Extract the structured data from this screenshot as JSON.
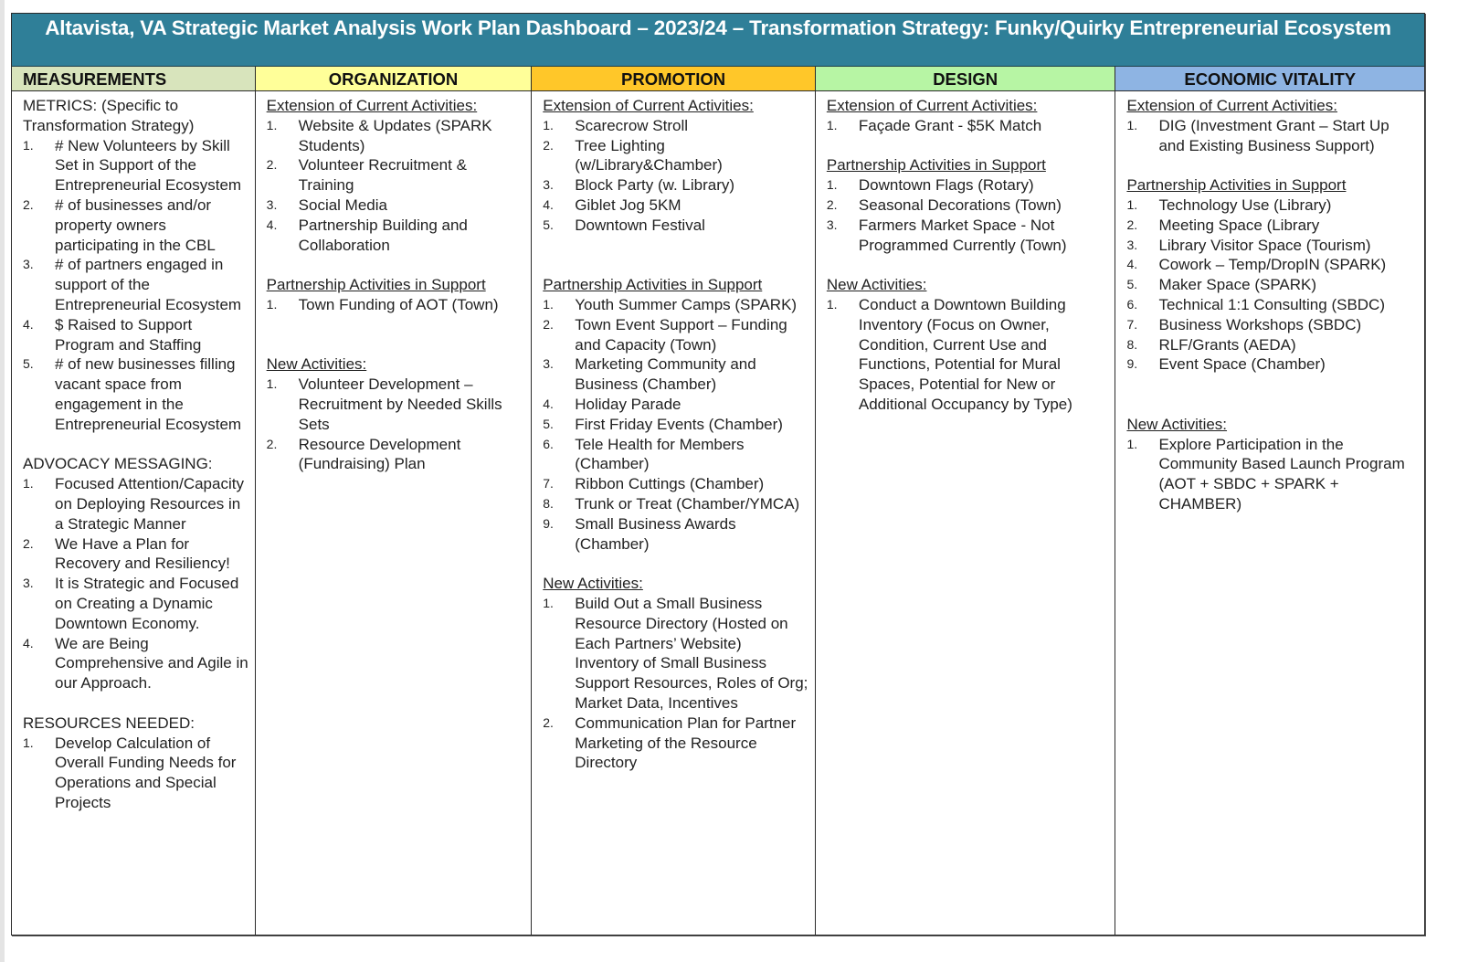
{
  "title": "Altavista, VA Strategic Market Analysis Work Plan Dashboard – 2023/24 – Transformation Strategy: Funky/Quirky Entrepreneurial Ecosystem",
  "colors": {
    "title_bg": "#2f7f98",
    "measurements_bg": "#d8e4bc",
    "organization_bg": "#ffff99",
    "promotion_bg": "#ffc729",
    "design_bg": "#b7f5a4",
    "economic_vitality_bg": "#8eb4e3"
  },
  "columns": [
    {
      "key": "measurements",
      "header": "MEASUREMENTS",
      "sections": [
        {
          "title": "METRICS: (Specific to Transformation Strategy)",
          "underline": false,
          "items": [
            "# New Volunteers by Skill Set in Support of the Entrepreneurial Ecosystem",
            "# of businesses and/or property owners participating in the CBL",
            "# of partners engaged in support of the Entrepreneurial Ecosystem",
            "$ Raised to Support Program and Staffing",
            "# of new businesses filling vacant space from engagement in the Entrepreneurial Ecosystem"
          ]
        },
        {
          "title": "ADVOCACY MESSAGING:",
          "underline": false,
          "items": [
            "Focused Attention/Capacity on Deploying Resources in a Strategic Manner",
            "We Have a Plan for Recovery and Resiliency!",
            "It is Strategic and Focused on Creating a Dynamic Downtown Economy.",
            "We are Being Comprehensive and Agile in our Approach."
          ]
        },
        {
          "title": "RESOURCES NEEDED:",
          "underline": false,
          "items": [
            "Develop Calculation of Overall Funding Needs for Operations and Special Projects"
          ]
        }
      ]
    },
    {
      "key": "organization",
      "header": "ORGANIZATION",
      "sections": [
        {
          "title": "Extension of Current Activities:",
          "underline": true,
          "items": [
            "Website & Updates (SPARK Students)",
            "Volunteer Recruitment & Training",
            "Social Media",
            "Partnership Building and Collaboration"
          ]
        },
        {
          "title": "Partnership Activities in Support",
          "underline": true,
          "items": [
            "Town Funding of AOT (Town)"
          ]
        },
        {
          "title": "New Activities:",
          "underline": true,
          "items": [
            "Volunteer Development – Recruitment by Needed Skills Sets",
            "Resource Development (Fundraising) Plan"
          ]
        }
      ]
    },
    {
      "key": "promotion",
      "header": "PROMOTION",
      "sections": [
        {
          "title": "Extension of Current Activities:",
          "underline": true,
          "items": [
            "Scarecrow Stroll",
            "Tree Lighting (w/Library&Chamber)",
            "Block Party (w. Library)",
            "Giblet Jog 5KM",
            "Downtown Festival"
          ]
        },
        {
          "title": "Partnership Activities in Support",
          "underline": true,
          "items": [
            "Youth Summer Camps (SPARK)",
            "Town Event Support – Funding and Capacity (Town)",
            "Marketing Community and Business (Chamber)",
            "Holiday Parade",
            "First Friday Events (Chamber)",
            "Tele Health for Members (Chamber)",
            "Ribbon Cuttings (Chamber)",
            "Trunk or Treat (Chamber/YMCA)",
            "Small Business Awards (Chamber)"
          ]
        },
        {
          "title": "New Activities:",
          "underline": true,
          "items": [
            "Build Out a Small Business Resource Directory (Hosted on Each Partners’ Website) Inventory of Small Business Support Resources, Roles of Org; Market Data, Incentives",
            "Communication Plan for Partner Marketing of the Resource Directory"
          ]
        }
      ]
    },
    {
      "key": "design",
      "header": "DESIGN",
      "sections": [
        {
          "title": "Extension of Current Activities:",
          "underline": true,
          "items": [
            "Façade Grant - $5K Match"
          ]
        },
        {
          "title": "Partnership Activities in Support",
          "underline": true,
          "items": [
            "Downtown Flags (Rotary)",
            "Seasonal Decorations (Town)",
            "Farmers Market Space - Not Programmed Currently (Town)"
          ]
        },
        {
          "title": "New Activities:",
          "underline": true,
          "items": [
            "Conduct a Downtown Building Inventory (Focus on Owner, Condition, Current Use and Functions, Potential for Mural Spaces, Potential for New or Additional Occupancy by Type)"
          ]
        }
      ]
    },
    {
      "key": "economic_vitality",
      "header": "ECONOMIC VITALITY",
      "sections": [
        {
          "title": "Extension of Current Activities:",
          "underline": true,
          "items": [
            "DIG (Investment Grant – Start Up and Existing Business Support)"
          ]
        },
        {
          "title": "Partnership Activities in Support",
          "underline": true,
          "items": [
            "Technology Use (Library)",
            "Meeting Space (Library",
            "Library Visitor Space (Tourism)",
            "Cowork – Temp/DropIN (SPARK)",
            "Maker Space (SPARK)",
            "Technical 1:1 Consulting (SBDC)",
            "Business Workshops (SBDC)",
            "RLF/Grants (AEDA)",
            "Event Space (Chamber)"
          ]
        },
        {
          "title": "New Activities:",
          "underline": true,
          "items": [
            "Explore Participation in the Community Based Launch Program (AOT + SBDC + SPARK + CHAMBER)"
          ]
        }
      ]
    }
  ]
}
